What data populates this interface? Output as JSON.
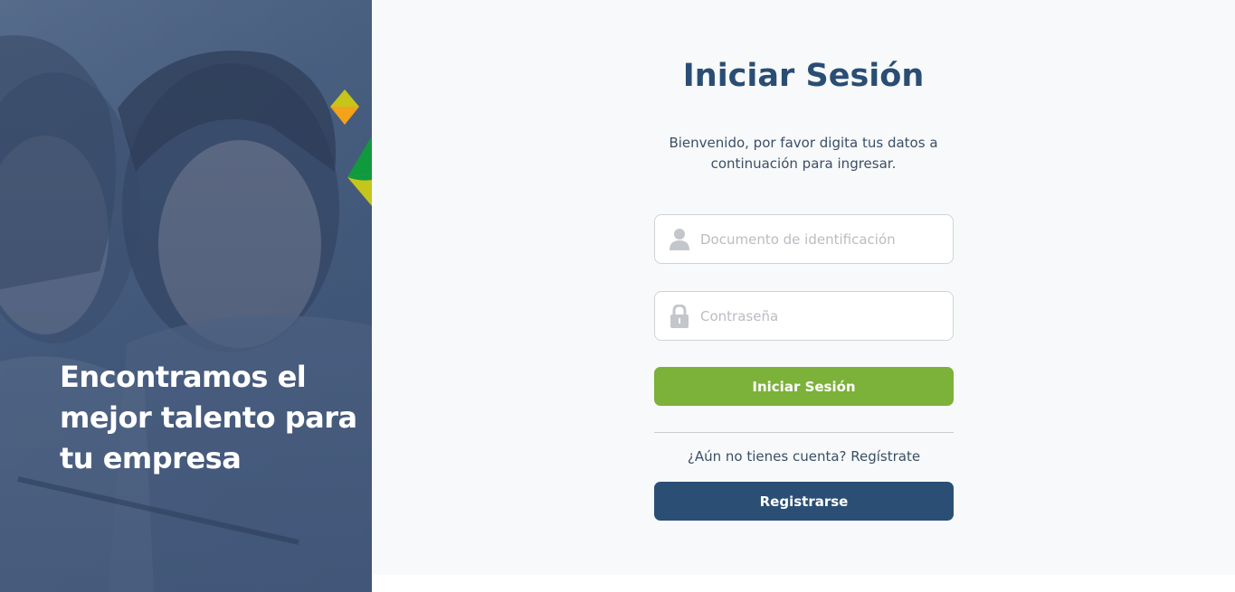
{
  "hero": {
    "headline_lines": [
      "Encontramos el",
      "mejor talento para",
      "tu empresa"
    ]
  },
  "login": {
    "title": "Iniciar Sesión",
    "subtitle_lines": [
      "Bienvenido, por favor digita tus datos a",
      "continuación para ingresar."
    ],
    "document_placeholder": "Documento de identificación",
    "document_value": "",
    "password_placeholder": "Contraseña",
    "password_value": "",
    "login_button": "Iniciar Sesión",
    "register_prompt": "¿Aún no tienes cuenta? Regístrate",
    "register_button": "Registrarse"
  },
  "icons": {
    "document_field": "user-icon",
    "password_field": "lock-icon"
  },
  "colors": {
    "title": "#2a4d74",
    "login_button": "#7cb13a",
    "register_button": "#2b4f74",
    "diamond_orange": "#f4a21a",
    "diamond_green": "#0f9a3e",
    "diamond_yellow": "#c6c51b"
  }
}
